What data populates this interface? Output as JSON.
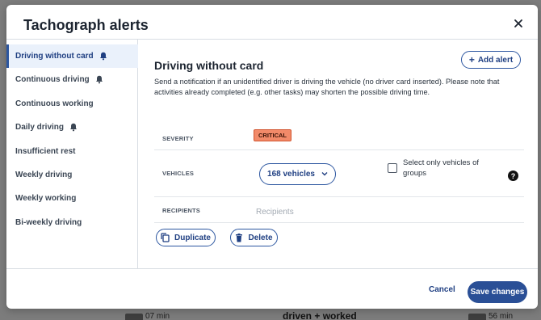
{
  "modal": {
    "title": "Tachograph alerts",
    "close_icon": "close-icon"
  },
  "sidebar": {
    "items": [
      {
        "label": "Driving without card",
        "active": true,
        "has_bell": true
      },
      {
        "label": "Continuous driving",
        "active": false,
        "has_bell": true
      },
      {
        "label": "Continuous working",
        "active": false,
        "has_bell": false
      },
      {
        "label": "Daily driving",
        "active": false,
        "has_bell": true
      },
      {
        "label": "Insufficient rest",
        "active": false,
        "has_bell": false
      },
      {
        "label": "Weekly driving",
        "active": false,
        "has_bell": false
      },
      {
        "label": "Weekly working",
        "active": false,
        "has_bell": false
      },
      {
        "label": "Bi-weekly driving",
        "active": false,
        "has_bell": false
      }
    ]
  },
  "content": {
    "title": "Driving without card",
    "add_alert_label": "Add alert",
    "description": "Send a notification if an unidentified driver is driving the vehicle (no driver card inserted). Please note that activities already completed (e.g. other tasks) may shorten the possible driving time.",
    "severity": {
      "label": "SEVERITY",
      "value": "CRITICAL",
      "color": "#f28a69"
    },
    "vehicles": {
      "label": "VEHICLES",
      "selected": "168 vehicles",
      "checkbox_label": "Select only vehicles of groups",
      "checked": false
    },
    "recipients": {
      "label": "RECIPIENTS",
      "placeholder": "Recipients",
      "value": ""
    },
    "duplicate_label": "Duplicate",
    "delete_label": "Delete"
  },
  "footer": {
    "cancel_label": "Cancel",
    "save_label": "Save changes"
  },
  "background": {
    "left_text": "07 min",
    "middle_text": "driven + worked",
    "right_text": "56 min"
  },
  "colors": {
    "accent": "#2c56a0",
    "save_bg": "#2a4f96",
    "critical": "#f28a69"
  }
}
